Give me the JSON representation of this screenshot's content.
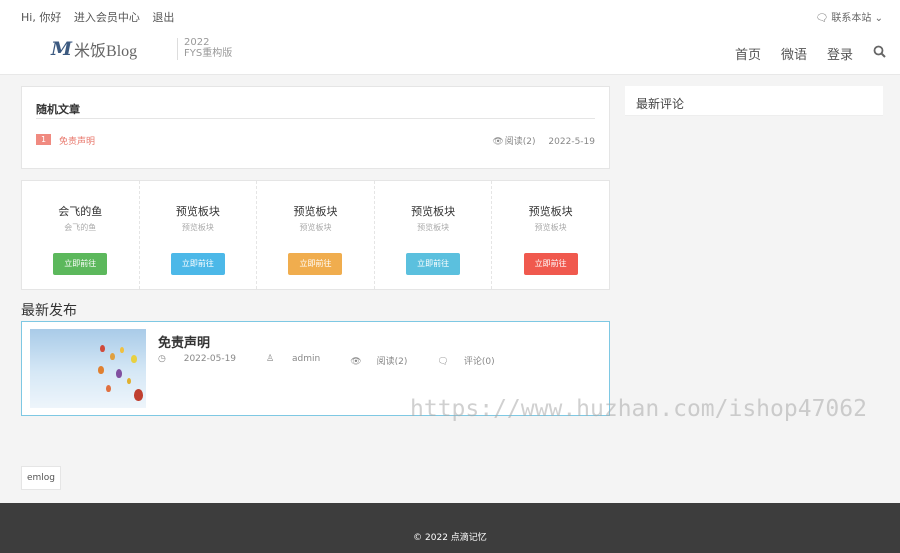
{
  "topbar": {
    "greeting": "Hi, 你好",
    "member": "进入会员中心",
    "logout": "退出",
    "contact": "联系本站"
  },
  "logo": {
    "name": "米饭Blog",
    "year": "2022",
    "edition": "FYS重构版"
  },
  "nav": {
    "home": "首页",
    "weiyu": "微语",
    "login": "登录"
  },
  "random": {
    "title": "随机文章",
    "items": [
      {
        "rank": "1",
        "title": "免责声明",
        "views": "阅读(2)",
        "date": "2022-5-19"
      }
    ]
  },
  "comments": {
    "title": "最新评论"
  },
  "blocks": [
    {
      "title": "会飞的鱼",
      "subtitle": "会飞的鱼",
      "button": "立即前往",
      "color": "#5cb85c"
    },
    {
      "title": "预览板块",
      "subtitle": "预览板块",
      "button": "立即前往",
      "color": "#4cb8e8"
    },
    {
      "title": "预览板块",
      "subtitle": "预览板块",
      "button": "立即前往",
      "color": "#f0ad4e"
    },
    {
      "title": "预览板块",
      "subtitle": "预览板块",
      "button": "立即前往",
      "color": "#5bc0de"
    },
    {
      "title": "预览板块",
      "subtitle": "预览板块",
      "button": "立即前往",
      "color": "#f0594e"
    }
  ],
  "latest": {
    "title": "最新发布",
    "post": {
      "title": "免责声明",
      "date": "2022-05-19",
      "author": "admin",
      "views": "阅读(2)",
      "comments": "评论(0)"
    }
  },
  "watermark": "https://www.huzhan.com/ishop47062",
  "tag": "emlog",
  "footer": "© 2022 点滴记忆"
}
